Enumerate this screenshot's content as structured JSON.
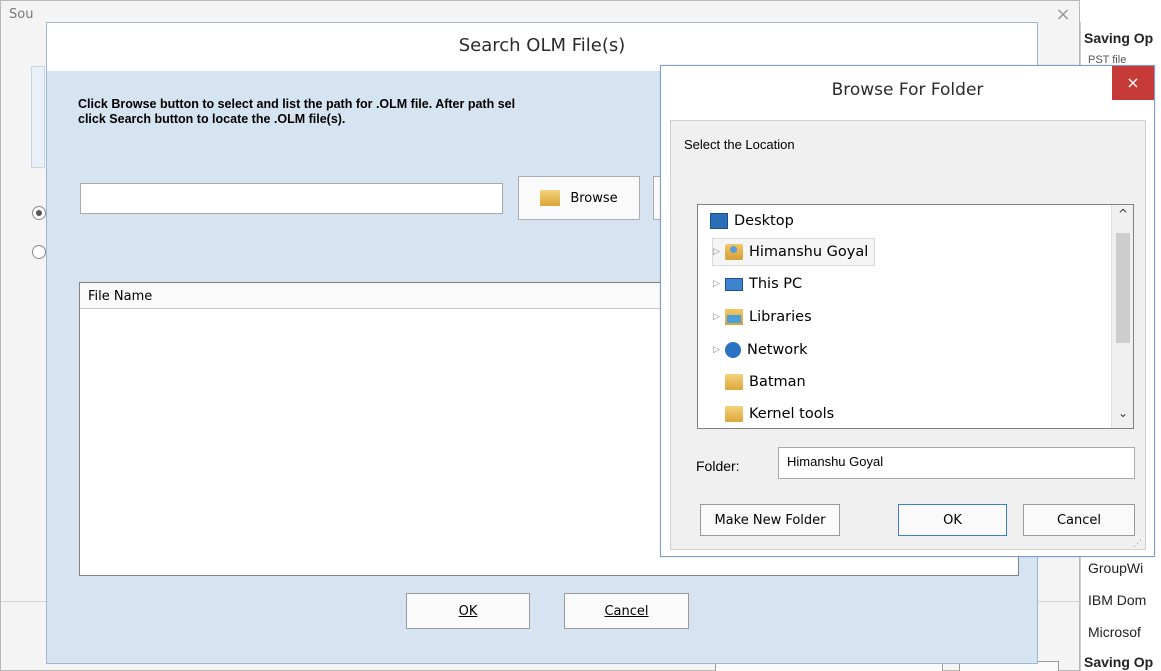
{
  "background_window": {
    "title_partial": "Sou",
    "close_glyph": "×"
  },
  "right_panel": {
    "items": [
      "Saving Op",
      "PST file",
      "GroupWi",
      "IBM Dom",
      "Microsof",
      "Saving Op"
    ]
  },
  "search_dialog": {
    "title": "Search OLM File(s)",
    "instructions": "Click Browse button to select and list the path for .OLM file. After path sel",
    "instructions_line2": "click Search button to locate the .OLM file(s).",
    "path_value": "",
    "browse_label": "Browse",
    "list_header": "File Name",
    "ok_label": "OK",
    "cancel_label": "Cancel"
  },
  "browse_dialog": {
    "title": "Browse For Folder",
    "close_glyph": "×",
    "prompt": "Select the Location",
    "tree": [
      {
        "label": "Desktop",
        "icon": "desktop-icon",
        "expandable": false
      },
      {
        "label": "Himanshu Goyal",
        "icon": "user-folder-icon",
        "expandable": true,
        "selected": true
      },
      {
        "label": "This PC",
        "icon": "computer-icon",
        "expandable": true
      },
      {
        "label": "Libraries",
        "icon": "libraries-icon",
        "expandable": true
      },
      {
        "label": "Network",
        "icon": "network-icon",
        "expandable": true
      },
      {
        "label": "Batman",
        "icon": "folder-icon",
        "expandable": false
      },
      {
        "label": "Kernel tools",
        "icon": "folder-icon",
        "expandable": false
      }
    ],
    "folder_label": "Folder:",
    "folder_value": "Himanshu Goyal",
    "make_new_folder_label": "Make New Folder",
    "ok_label": "OK",
    "cancel_label": "Cancel"
  }
}
